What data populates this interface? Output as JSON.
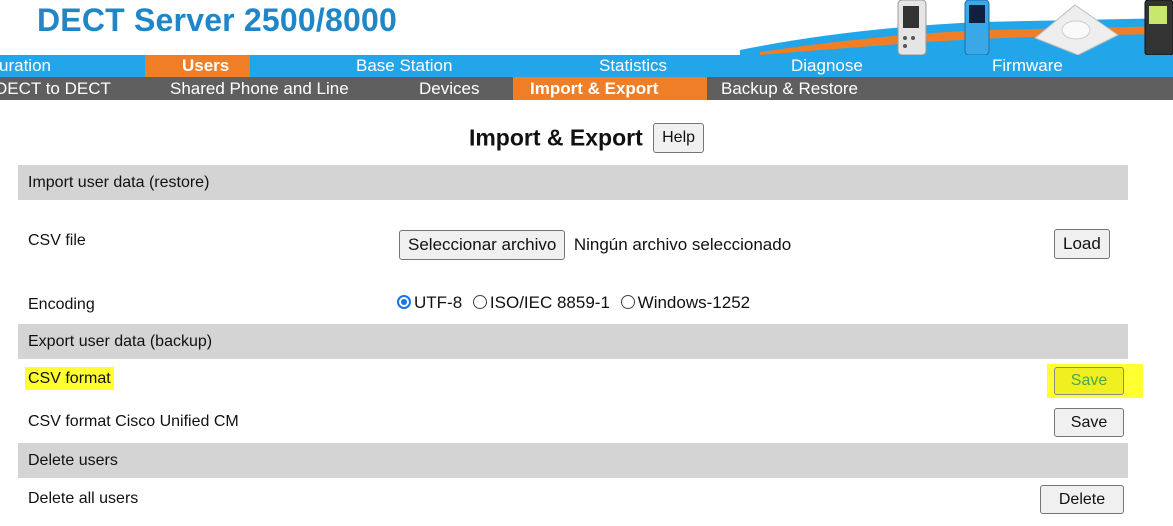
{
  "header": {
    "title": "DECT Server 2500/8000"
  },
  "nav_main": [
    {
      "label": "uration",
      "active": false
    },
    {
      "label": "Users",
      "active": true
    },
    {
      "label": "Base Station",
      "active": false
    },
    {
      "label": "Statistics",
      "active": false
    },
    {
      "label": "Diagnose",
      "active": false
    },
    {
      "label": "Firmware",
      "active": false
    }
  ],
  "nav_sub": [
    {
      "label": "DECT to DECT",
      "active": false
    },
    {
      "label": "Shared Phone and Line",
      "active": false
    },
    {
      "label": "Devices",
      "active": false
    },
    {
      "label": "Import & Export",
      "active": true
    },
    {
      "label": "Backup & Restore",
      "active": false
    }
  ],
  "page": {
    "heading": "Import & Export",
    "help_label": "Help"
  },
  "import": {
    "section_title": "Import user data (restore)",
    "csv_file_label": "CSV file",
    "choose_file_label": "Seleccionar archivo",
    "no_file_text": "Ningún archivo seleccionado",
    "load_label": "Load",
    "encoding_label": "Encoding",
    "encodings": [
      {
        "label": "UTF-8",
        "checked": true
      },
      {
        "label": "ISO/IEC 8859-1",
        "checked": false
      },
      {
        "label": "Windows-1252",
        "checked": false
      }
    ]
  },
  "export": {
    "section_title": "Export user data (backup)",
    "csv_format_label": "CSV format",
    "csv_format_save": "Save",
    "cisco_label": "CSV format Cisco Unified CM",
    "cisco_save": "Save"
  },
  "delete": {
    "section_title": "Delete users",
    "delete_all_label": "Delete all users",
    "delete_label": "Delete"
  },
  "colors": {
    "brand_blue": "#1f86c8",
    "nav_blue": "#23a6e9",
    "nav_gray": "#5f5f5f",
    "active_orange": "#f07e26",
    "section_gray": "#d4d4d4",
    "highlight_yellow": "#ffff33"
  }
}
